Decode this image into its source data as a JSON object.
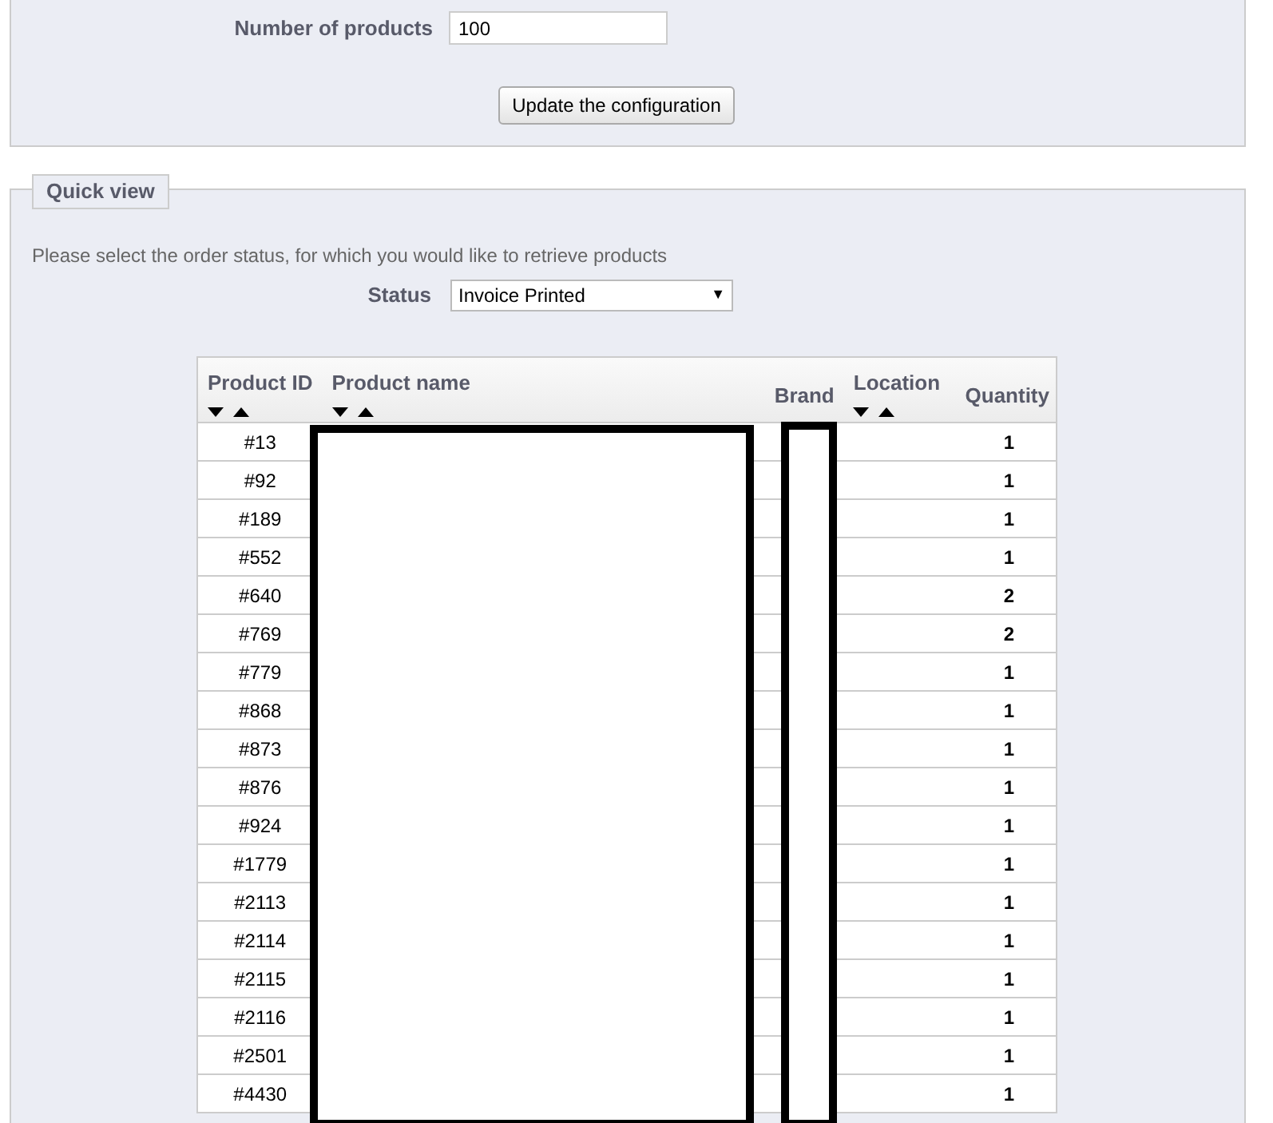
{
  "config_panel": {
    "label": "Number of products",
    "value": "100",
    "button": "Update the configuration"
  },
  "quick_view": {
    "legend": "Quick view",
    "instruction": "Please select the order status, for which you would like to retrieve products",
    "status_label": "Status",
    "status_value": "Invoice Printed",
    "select_arrow": "▼",
    "table": {
      "columns": [
        {
          "label": "Product ID",
          "sortable": true
        },
        {
          "label": "Product name",
          "sortable": true
        },
        {
          "label": "Brand",
          "sortable": false
        },
        {
          "label": "Location",
          "sortable": true
        },
        {
          "label": "Quantity",
          "sortable": false
        }
      ],
      "rows": [
        {
          "id": "#13",
          "quantity": "1"
        },
        {
          "id": "#92",
          "quantity": "1"
        },
        {
          "id": "#189",
          "quantity": "1"
        },
        {
          "id": "#552",
          "quantity": "1"
        },
        {
          "id": "#640",
          "quantity": "2"
        },
        {
          "id": "#769",
          "quantity": "2"
        },
        {
          "id": "#779",
          "quantity": "1"
        },
        {
          "id": "#868",
          "quantity": "1"
        },
        {
          "id": "#873",
          "quantity": "1"
        },
        {
          "id": "#876",
          "quantity": "1"
        },
        {
          "id": "#924",
          "quantity": "1"
        },
        {
          "id": "#1779",
          "quantity": "1"
        },
        {
          "id": "#2113",
          "quantity": "1"
        },
        {
          "id": "#2114",
          "quantity": "1"
        },
        {
          "id": "#2115",
          "quantity": "1"
        },
        {
          "id": "#2116",
          "quantity": "1"
        },
        {
          "id": "#2501",
          "quantity": "1"
        },
        {
          "id": "#4430",
          "quantity": "1"
        }
      ]
    }
  }
}
